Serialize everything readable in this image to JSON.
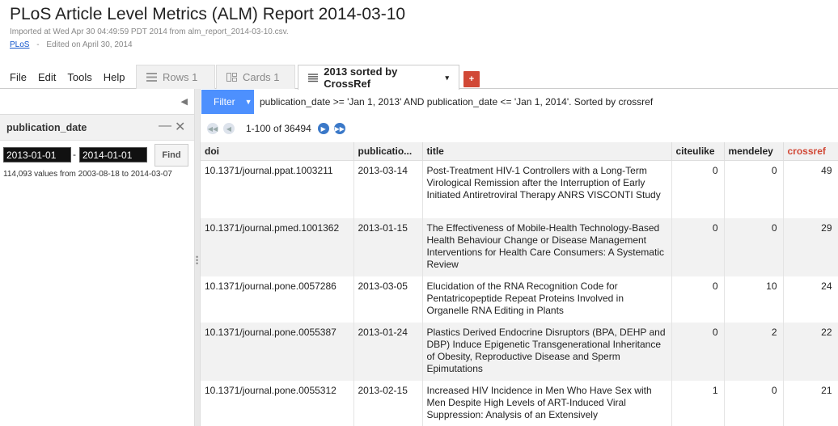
{
  "header": {
    "title": "PLoS Article Level Metrics (ALM) Report 2014-03-10",
    "imported": "Imported at Wed Apr 30 04:49:59 PDT 2014 from alm_report_2014-03-10.csv.",
    "owner": "PLoS",
    "sep": "-",
    "edited": "Edited on April 30, 2014"
  },
  "menu": [
    "File",
    "Edit",
    "Tools",
    "Help"
  ],
  "tabs": {
    "rows": "Rows 1",
    "cards": "Cards 1",
    "active": "2013 sorted by CrossRef",
    "add": "+"
  },
  "sidebar": {
    "facet_title": "publication_date",
    "from": "2013-01-01",
    "dash": "-",
    "to": "2014-01-01",
    "find": "Find",
    "values_note": "114,093 values from 2003-08-18 to 2014-03-07"
  },
  "filter": {
    "button": "Filter",
    "text": "publication_date >= 'Jan 1, 2013' AND publication_date <= 'Jan 1, 2014'. Sorted by crossref"
  },
  "pager": {
    "text": "1-100 of 36494"
  },
  "table": {
    "headers": [
      "doi",
      "publicatio...",
      "title",
      "citeulike",
      "mendeley",
      "crossref"
    ],
    "sorted_color": "#d14836",
    "rows": [
      {
        "doi": "10.1371/journal.ppat.1003211",
        "date": "2013-03-14",
        "title": "Post-Treatment HIV-1 Controllers with a Long-Term Virological Remission after the Interruption of Early Initiated Antiretroviral Therapy ANRS VISCONTI Study",
        "citeulike": "0",
        "mendeley": "0",
        "crossref": "49"
      },
      {
        "doi": "10.1371/journal.pmed.1001362",
        "date": "2013-01-15",
        "title": "The Effectiveness of Mobile-Health Technology-Based Health Behaviour Change or Disease Management Interventions for Health Care Consumers: A Systematic Review",
        "citeulike": "0",
        "mendeley": "0",
        "crossref": "29"
      },
      {
        "doi": "10.1371/journal.pone.0057286",
        "date": "2013-03-05",
        "title": "Elucidation of the RNA Recognition Code for Pentatricopeptide Repeat Proteins Involved in Organelle RNA Editing in Plants",
        "citeulike": "0",
        "mendeley": "10",
        "crossref": "24"
      },
      {
        "doi": "10.1371/journal.pone.0055387",
        "date": "2013-01-24",
        "title": "Plastics Derived Endocrine Disruptors (BPA, DEHP and DBP) Induce Epigenetic Transgenerational Inheritance of Obesity, Reproductive Disease and Sperm Epimutations",
        "citeulike": "0",
        "mendeley": "2",
        "crossref": "22"
      },
      {
        "doi": "10.1371/journal.pone.0055312",
        "date": "2013-02-15",
        "title": "Increased HIV Incidence in Men Who Have Sex with Men Despite High Levels of ART-Induced Viral Suppression: Analysis of an Extensively",
        "citeulike": "1",
        "mendeley": "0",
        "crossref": "21"
      }
    ]
  }
}
